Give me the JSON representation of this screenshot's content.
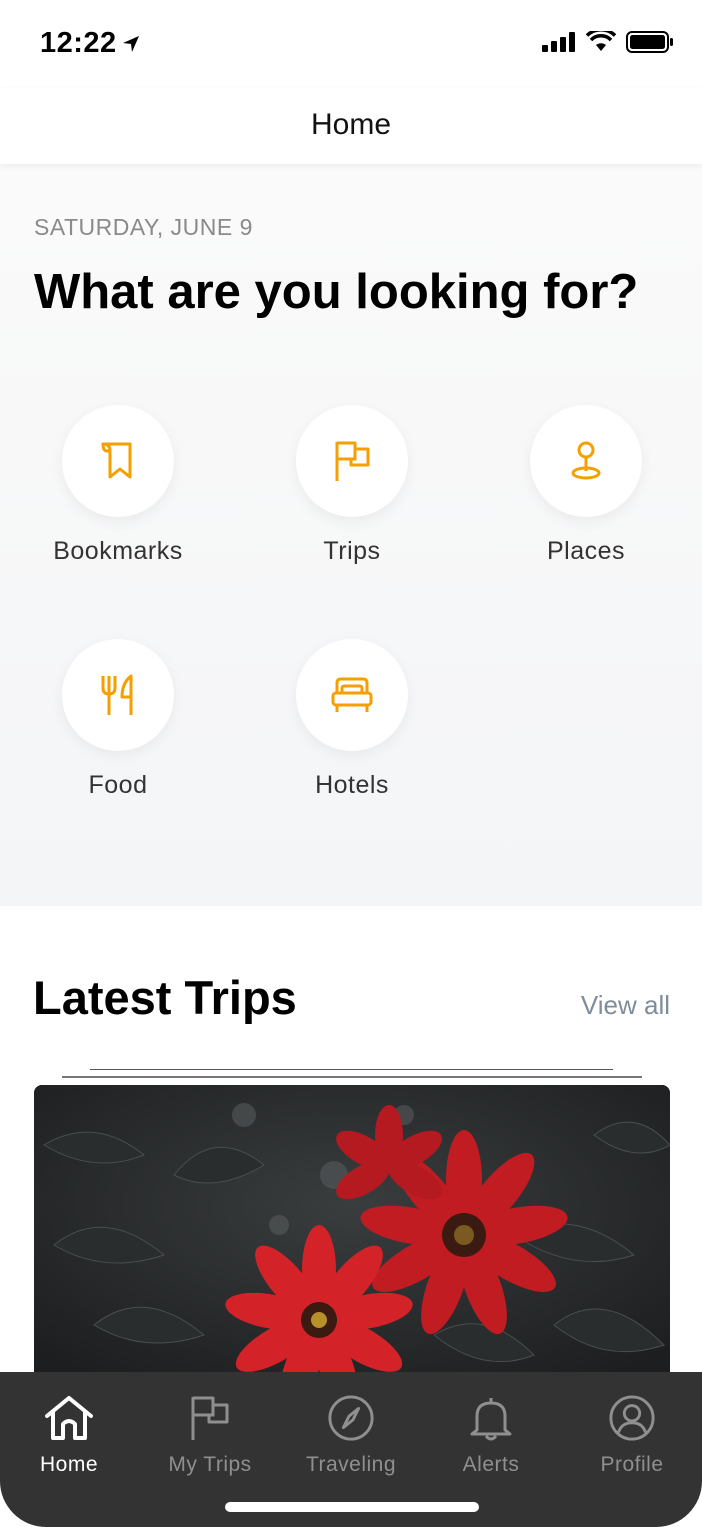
{
  "status": {
    "time": "12:22"
  },
  "nav": {
    "title": "Home"
  },
  "hero": {
    "date": "SATURDAY, JUNE 9",
    "headline": "What are you looking for?",
    "categories": [
      {
        "label": "Bookmarks",
        "icon": "bookmark-icon"
      },
      {
        "label": "Trips",
        "icon": "flag-icon"
      },
      {
        "label": "Places",
        "icon": "pin-icon"
      },
      {
        "label": "Food",
        "icon": "fork-knife-icon"
      },
      {
        "label": "Hotels",
        "icon": "bed-icon"
      }
    ]
  },
  "latest": {
    "title": "Latest Trips",
    "view_all": "View all"
  },
  "tabs": [
    {
      "label": "Home",
      "icon": "home-icon",
      "active": true
    },
    {
      "label": "My Trips",
      "icon": "flag-icon",
      "active": false
    },
    {
      "label": "Traveling",
      "icon": "compass-icon",
      "active": false
    },
    {
      "label": "Alerts",
      "icon": "bell-icon",
      "active": false
    },
    {
      "label": "Profile",
      "icon": "user-icon",
      "active": false
    }
  ],
  "colors": {
    "accent": "#f5a000",
    "tab_bar": "#333333",
    "muted": "#8f8f8f",
    "link": "#7f8c9b"
  }
}
